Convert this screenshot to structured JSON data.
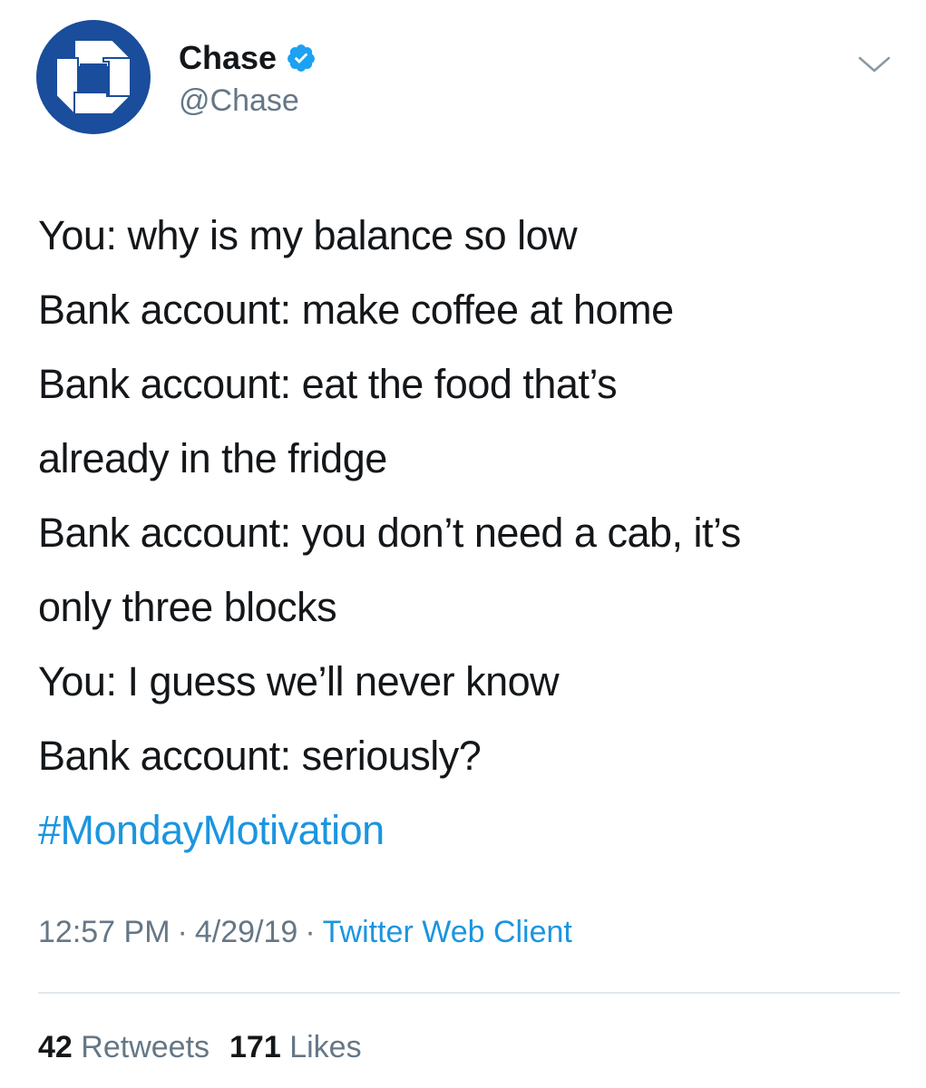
{
  "header": {
    "display_name": "Chase",
    "handle": "@Chase",
    "verified": true,
    "avatar_icon": "chase-octagon-logo-icon",
    "avatar_color": "#1a4d9c",
    "verified_color": "#1da1f2",
    "menu_icon": "chevron-down-icon"
  },
  "tweet": {
    "lines": [
      "You: why is my balance so low",
      "Bank account: make coffee at home",
      "Bank account: eat the food that’s",
      "already in the fridge",
      "Bank account: you don’t need a cab, it’s",
      "only three blocks",
      "You: I guess we’ll never know",
      "Bank account: seriously?"
    ],
    "hashtag": "#MondayMotivation",
    "hashtag_color": "#1b95e0"
  },
  "meta": {
    "time": "12:57 PM",
    "separator": "·",
    "date": "4/29/19",
    "client": "Twitter Web Client"
  },
  "stats": {
    "retweets_count": "42",
    "retweets_label": "Retweets",
    "likes_count": "171",
    "likes_label": "Likes"
  }
}
